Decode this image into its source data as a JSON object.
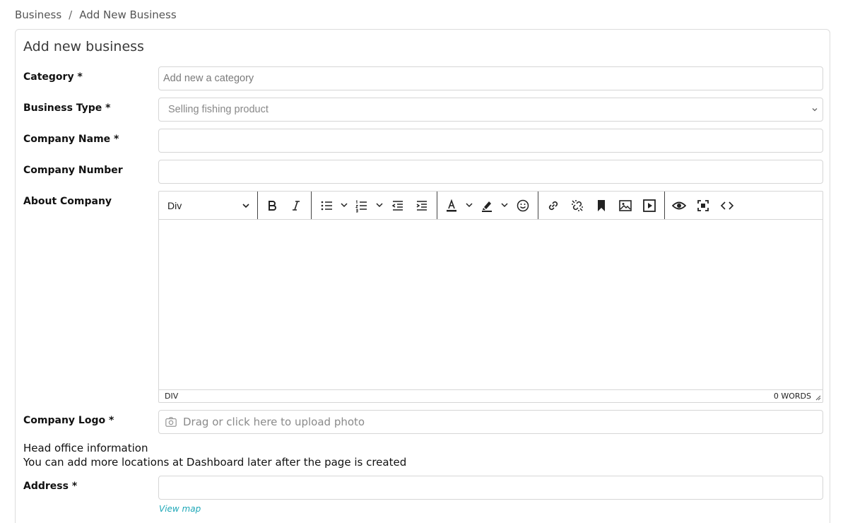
{
  "breadcrumb": {
    "parent": "Business",
    "separator": "/",
    "current": "Add New Business"
  },
  "form": {
    "title": "Add new business",
    "category": {
      "label": "Category *",
      "placeholder": "Add new a category"
    },
    "business_type": {
      "label": "Business Type *",
      "selected": "Selling fishing product"
    },
    "company_name": {
      "label": "Company Name *",
      "value": ""
    },
    "company_number": {
      "label": "Company Number",
      "value": ""
    },
    "about_company": {
      "label": "About Company",
      "block_format": "Div",
      "status_path": "DIV",
      "word_count": "0 WORDS",
      "toolbar_icons": [
        "bold-icon",
        "italic-icon",
        "bullet-list-icon",
        "numbered-list-icon",
        "outdent-icon",
        "indent-icon",
        "text-color-icon",
        "highlight-icon",
        "emoji-icon",
        "link-icon",
        "unlink-icon",
        "bookmark-icon",
        "image-icon",
        "video-icon",
        "preview-icon",
        "fullscreen-icon",
        "source-code-icon"
      ]
    },
    "company_logo": {
      "label": "Company Logo *",
      "placeholder": "Drag or click here to upload photo"
    },
    "head_office": {
      "heading": "Head office information",
      "note": "You can add more locations at Dashboard later after the page is created"
    },
    "address": {
      "label": "Address *",
      "value": "",
      "view_map": "View map"
    }
  },
  "colors": {
    "accent_link": "#1fa8b8",
    "border": "#d6d6d6"
  }
}
